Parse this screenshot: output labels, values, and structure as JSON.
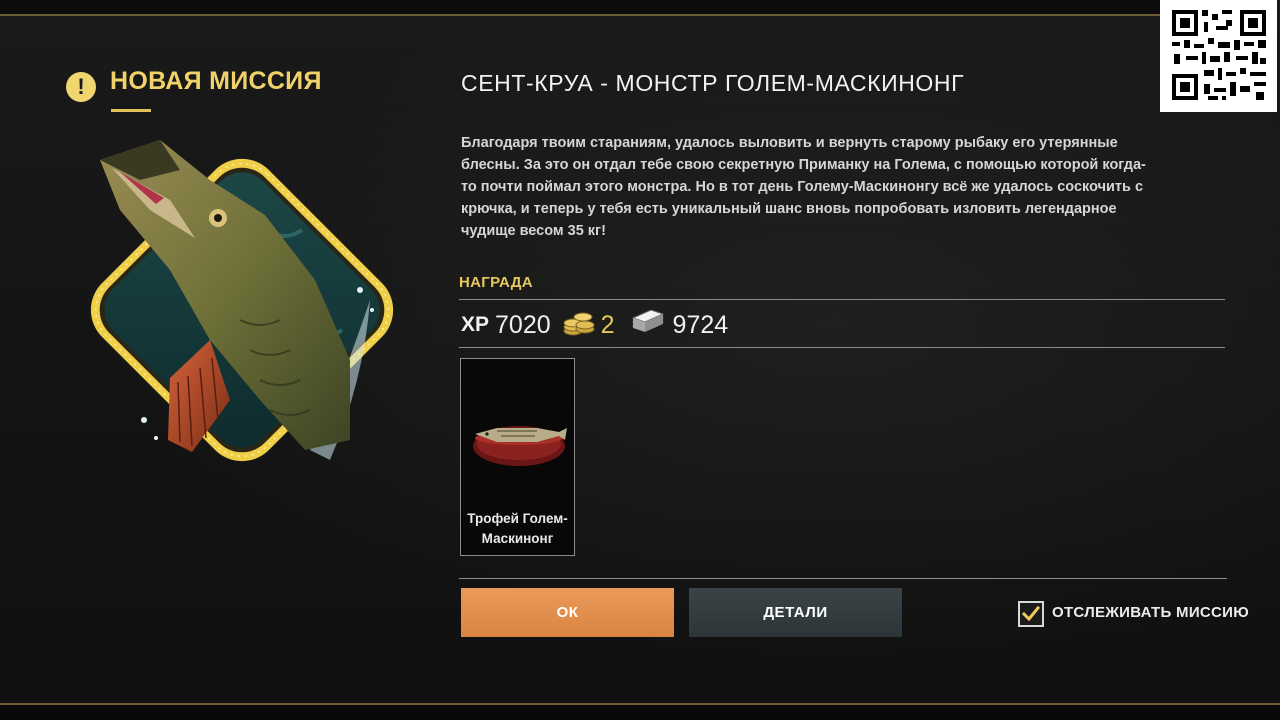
{
  "header": {
    "notice_icon": "exclamation-icon",
    "heading": "НОВАЯ МИССИЯ"
  },
  "mission": {
    "title": "СЕНТ-КРУА - МОНСТР ГОЛЕМ-МАСКИНОНГ",
    "description": "Благодаря твоим стараниям, удалось выловить и вернуть старому рыбаку его утерянные блесны. За это он отдал тебе свою секретную Приманку на Голема, с помощью которой когда-то почти поймал этого монстра. Но в тот день Голему-Маскинонгу всё же удалось соскочить с крючка, и теперь у тебя есть уникальный шанс вновь попробовать изловить легендарное чудище весом 35 кг!"
  },
  "reward": {
    "label": "НАГРАДА",
    "xp_label": "XP",
    "xp_value": "7020",
    "coin_icon": "gold-coins-icon",
    "coins_value": "2",
    "money_icon": "silver-money-icon",
    "money_value": "9724",
    "items": [
      {
        "name": "Трофей Голем-Маскинонг",
        "icon": "pike-trophy-icon"
      }
    ]
  },
  "buttons": {
    "ok": "ОК",
    "details": "ДЕТАЛИ"
  },
  "tracking": {
    "label": "ОТСЛЕЖИВАТЬ МИССИЮ",
    "checked": true
  },
  "colors": {
    "accent_gold": "#f1d26a",
    "ok_button": "#e2904c",
    "details_button": "#323c3e",
    "background": "#141414"
  }
}
